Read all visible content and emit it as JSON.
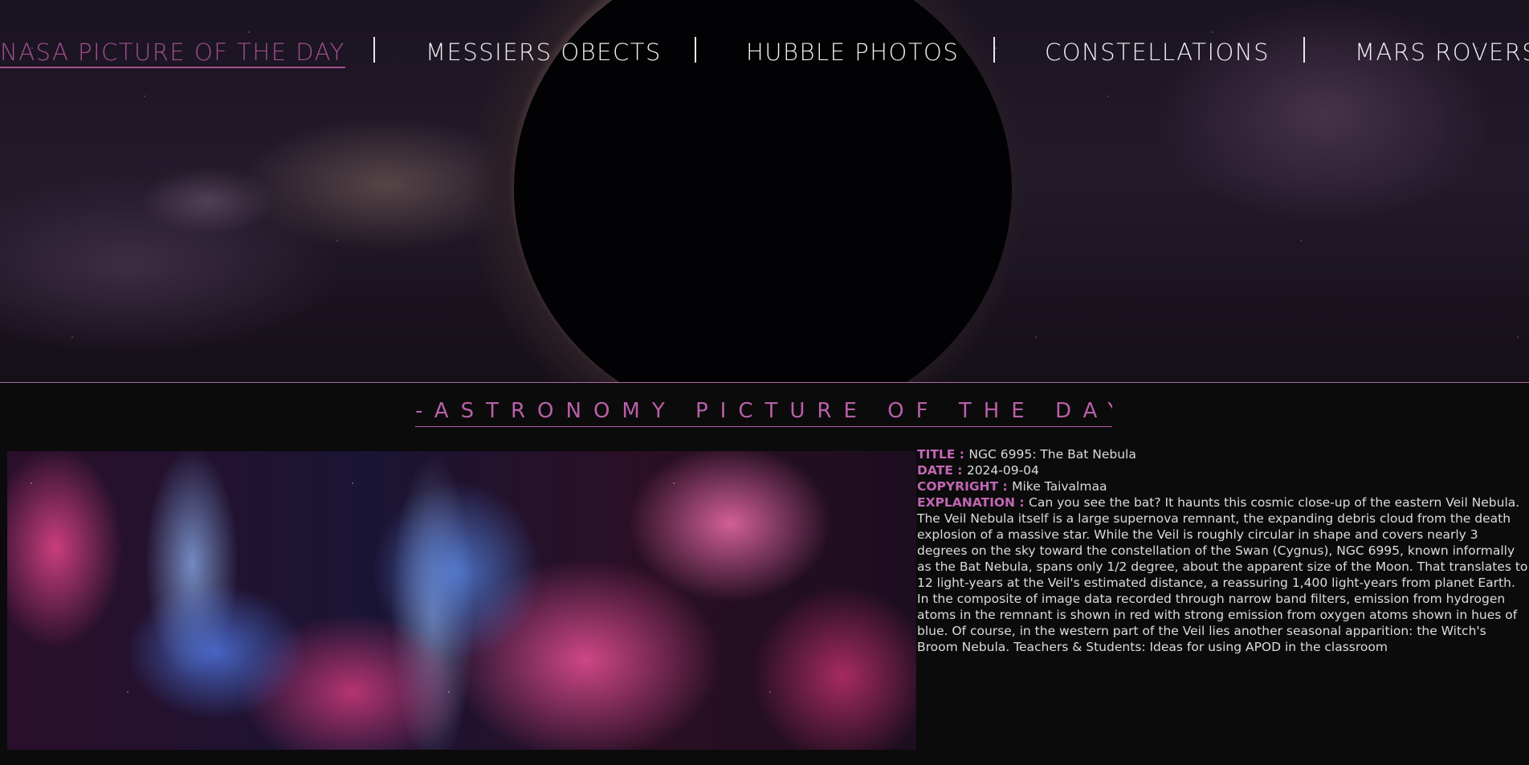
{
  "nav": {
    "items": [
      {
        "label": "NASA PICTURE OF THE DAY",
        "active": true
      },
      {
        "label": "MESSIERS OBECTS",
        "active": false
      },
      {
        "label": "HUBBLE PHOTOS",
        "active": false
      },
      {
        "label": "CONSTELLATIONS",
        "active": false
      },
      {
        "label": "MARS ROVERS",
        "active": false
      }
    ],
    "active_color": "#a0508f"
  },
  "section_title": "-ASTRONOMY PICTURE OF THE DAY-",
  "apod": {
    "title_label": "TITLE",
    "title": "NGC 6995: The Bat Nebula",
    "date_label": "DATE",
    "date": "2024-09-04",
    "copyright_label": "COPYRIGHT",
    "copyright": "Mike Taivalmaa",
    "explanation_label": "EXPLANATION",
    "explanation": "Can you see the bat? It haunts this cosmic close-up of the eastern Veil Nebula. The Veil Nebula itself is a large supernova remnant, the expanding debris cloud from the death explosion of a massive star. While the Veil is roughly circular in shape and covers nearly 3 degrees on the sky toward the constellation of the Swan (Cygnus), NGC 6995, known informally as the Bat Nebula, spans only 1/2 degree, about the apparent size of the Moon. That translates to 12 light-years at the Veil's estimated distance, a reassuring 1,400 light-years from planet Earth. In the composite of image data recorded through narrow band filters, emission from hydrogen atoms in the remnant is shown in red with strong emission from oxygen atoms shown in hues of blue. Of course, in the western part of the Veil lies another seasonal apparition: the Witch's Broom Nebula. Teachers & Students: Ideas for using APOD in the classroom"
  },
  "colors": {
    "accent": "#b85fa8",
    "background": "#0b0b0b"
  }
}
